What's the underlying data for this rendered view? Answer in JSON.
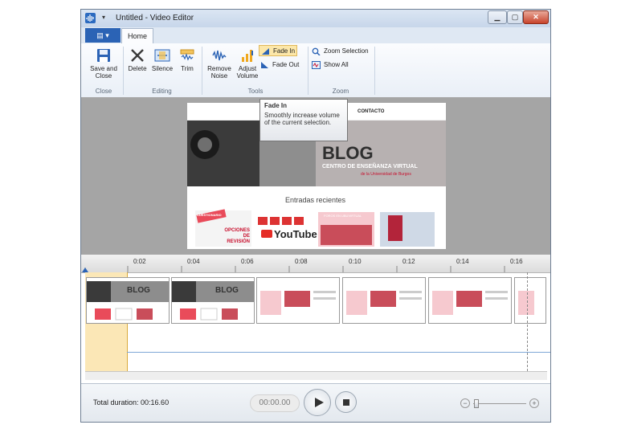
{
  "window": {
    "title": "Untitled - Video Editor",
    "app_icon": "waveform-icon",
    "qat_symbol": "▾"
  },
  "window_controls": {
    "minimize": "▁",
    "maximize": "▢",
    "close": "✕"
  },
  "tabs": {
    "file_symbol": "▤ ▾",
    "home": "Home"
  },
  "ribbon": {
    "save_and_close": "Save and\nClose",
    "delete": "Delete",
    "silence": "Silence",
    "trim": "Trim",
    "remove_noise": "Remove\nNoise",
    "adjust_volume": "Adjust\nVolume",
    "fade_in": "Fade In",
    "fade_out": "Fade Out",
    "zoom_selection": "Zoom Selection",
    "show_all": "Show All",
    "groups": {
      "close": "Close",
      "editing": "Editing",
      "tools": "Tools",
      "zoom": "Zoom"
    }
  },
  "tooltip": {
    "title": "Fade In",
    "body": "Smoothly increase volume of the current selection."
  },
  "preview": {
    "nav_contact": "CONTACTO",
    "blog_title": "BLOG",
    "blog_subtitle": "CENTRO DE ENSEÑANZA VIRTUAL",
    "blog_sub2": "de la Universidad de Burgos",
    "recent": "Entradas recientes",
    "card1_text": "OPCIONES DE REVISIÓN",
    "card1_tag": "CUESTIONARIO",
    "card2_text": "YouTube",
    "card3_tag": "FOROS EN UBUVIRTUAL"
  },
  "timeline": {
    "ticks": [
      "0:02",
      "0:04",
      "0:06",
      "0:08",
      "0:10",
      "0:12",
      "0:14",
      "0:16"
    ],
    "clip_labels": [
      "BLOG",
      "BLOG"
    ]
  },
  "status": {
    "total_duration": "Total duration: 00:16.60",
    "time": "00:00.00",
    "zoom_out": "−",
    "zoom_in": "+"
  },
  "colors": {
    "accent": "#2b63b5",
    "selection": "#fbe7b6",
    "preview_bg": "#a5a5a5",
    "brand_red": "#c8102e"
  }
}
